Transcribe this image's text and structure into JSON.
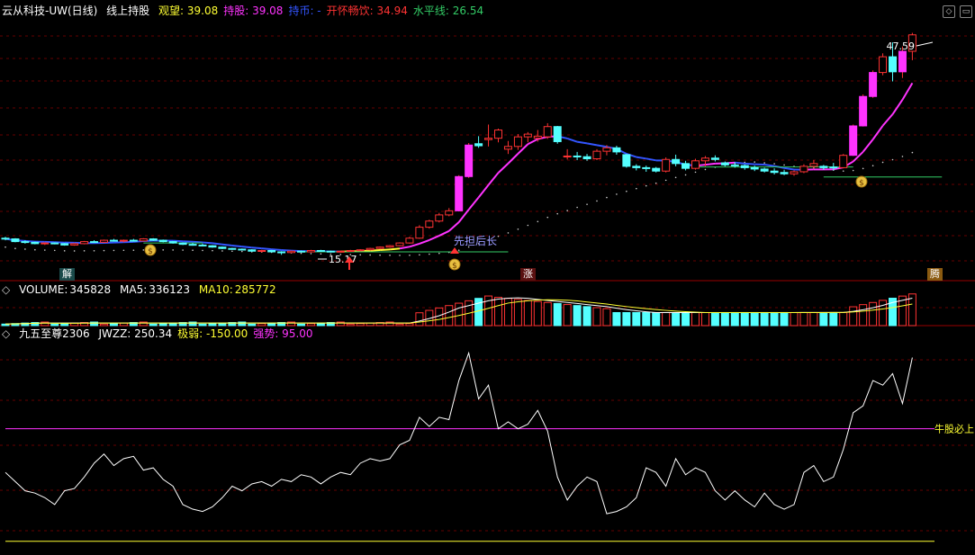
{
  "main_header": {
    "title": "云从科技-UW(日线)",
    "indicator": "线上持股",
    "items": [
      {
        "label": "观望:",
        "value": "39.08",
        "color": "#ffff33"
      },
      {
        "label": "持股:",
        "value": "39.08",
        "color": "#ff33ff"
      },
      {
        "label": "持币:",
        "value": "-",
        "color": "#3355ff"
      },
      {
        "label": "开怀畅饮:",
        "value": "34.94",
        "color": "#ff3333"
      },
      {
        "label": "水平线:",
        "value": "26.54",
        "color": "#33cc66"
      }
    ]
  },
  "volume_header": {
    "label": "VOLUME:",
    "value": "345828",
    "ma5_label": "MA5:",
    "ma5": "336123",
    "ma10_label": "MA10:",
    "ma10": "285772"
  },
  "osc_header": {
    "name": "九五至尊2306",
    "items": [
      {
        "label": "JWZZ:",
        "value": "250.34",
        "color": "#ffffff"
      },
      {
        "label": "极弱:",
        "value": "-150.00",
        "color": "#ffff33"
      },
      {
        "label": "强势:",
        "value": "95.00",
        "color": "#ff33ff"
      }
    ]
  },
  "annotations": {
    "high_price": "47.59",
    "low_price": "15.17",
    "text_mark": "先担后长",
    "osc_line_label": "牛股必上"
  },
  "tags": {
    "jie": "解",
    "zhang": "涨",
    "teng": "腾"
  },
  "colors": {
    "up": "#ff3333",
    "down": "#54ffff",
    "magenta": "#ff33ff",
    "blue": "#3355ff",
    "yellow": "#ffff33",
    "green": "#33cc66",
    "grid": "#660000"
  },
  "chart_data": {
    "type": "candlestick",
    "price_range": [
      13.5,
      49.5
    ],
    "candles": [
      [
        17.6,
        17.8,
        17.3,
        17.5
      ],
      [
        17.5,
        17.6,
        17.0,
        17.1
      ],
      [
        17.1,
        17.3,
        16.8,
        17.0
      ],
      [
        17.0,
        17.1,
        16.7,
        16.8
      ],
      [
        16.8,
        17.0,
        16.6,
        16.9
      ],
      [
        16.9,
        17.0,
        16.7,
        16.8
      ],
      [
        16.8,
        16.9,
        16.5,
        16.6
      ],
      [
        16.6,
        16.9,
        16.5,
        16.8
      ],
      [
        16.8,
        17.2,
        16.7,
        17.1
      ],
      [
        17.1,
        17.3,
        16.9,
        17.0
      ],
      [
        17.0,
        17.4,
        16.9,
        17.3
      ],
      [
        17.3,
        17.5,
        17.1,
        17.2
      ],
      [
        17.2,
        17.4,
        17.0,
        17.3
      ],
      [
        17.3,
        17.5,
        17.1,
        17.2
      ],
      [
        17.2,
        17.6,
        17.1,
        17.5
      ],
      [
        17.5,
        17.6,
        17.2,
        17.3
      ],
      [
        17.3,
        17.4,
        17.0,
        17.1
      ],
      [
        17.1,
        17.2,
        16.8,
        16.9
      ],
      [
        16.9,
        17.0,
        16.6,
        16.7
      ],
      [
        16.7,
        16.9,
        16.5,
        16.6
      ],
      [
        16.6,
        16.8,
        16.4,
        16.5
      ],
      [
        16.5,
        16.6,
        16.2,
        16.3
      ],
      [
        16.3,
        16.4,
        16.0,
        16.1
      ],
      [
        16.1,
        16.2,
        15.9,
        16.0
      ],
      [
        16.0,
        16.1,
        15.8,
        15.9
      ],
      [
        15.9,
        16.0,
        15.6,
        15.7
      ],
      [
        15.7,
        15.9,
        15.5,
        15.8
      ],
      [
        15.8,
        15.9,
        15.5,
        15.6
      ],
      [
        15.6,
        15.7,
        15.17,
        15.5
      ],
      [
        15.5,
        15.8,
        15.4,
        15.7
      ],
      [
        15.7,
        15.8,
        15.5,
        15.6
      ],
      [
        15.6,
        15.9,
        15.5,
        15.8
      ],
      [
        15.8,
        15.9,
        15.6,
        15.7
      ],
      [
        15.7,
        15.8,
        15.5,
        15.6
      ],
      [
        15.6,
        15.8,
        15.5,
        15.7
      ],
      [
        15.7,
        15.9,
        15.6,
        15.8
      ],
      [
        15.8,
        16.0,
        15.7,
        15.9
      ],
      [
        15.9,
        16.2,
        15.8,
        16.1
      ],
      [
        16.1,
        16.4,
        16.0,
        16.3
      ],
      [
        16.3,
        16.6,
        16.2,
        16.5
      ],
      [
        16.5,
        17.0,
        16.4,
        16.9
      ],
      [
        16.9,
        17.8,
        16.8,
        17.6
      ],
      [
        17.6,
        19.5,
        17.5,
        19.2
      ],
      [
        19.2,
        20.3,
        19.0,
        20.1
      ],
      [
        20.1,
        21.3,
        19.9,
        21.0
      ],
      [
        21.0,
        22.0,
        20.8,
        21.6
      ],
      [
        21.6,
        26.8,
        21.5,
        26.6
      ],
      [
        26.6,
        31.5,
        26.4,
        31.2
      ],
      [
        31.4,
        32.5,
        30.8,
        31.1
      ],
      [
        32.0,
        34.2,
        31.0,
        32.2
      ],
      [
        32.2,
        33.6,
        31.6,
        33.4
      ],
      [
        30.6,
        31.8,
        29.9,
        31.0
      ],
      [
        31.0,
        32.8,
        30.5,
        32.4
      ],
      [
        32.4,
        33.1,
        31.6,
        32.8
      ],
      [
        32.2,
        33.4,
        31.7,
        32.5
      ],
      [
        32.4,
        34.4,
        32.1,
        33.9
      ],
      [
        33.9,
        34.0,
        31.4,
        31.7
      ],
      [
        29.6,
        30.6,
        29.1,
        29.6
      ],
      [
        29.6,
        30.2,
        29.0,
        29.5
      ],
      [
        29.5,
        29.9,
        28.9,
        29.2
      ],
      [
        29.2,
        30.6,
        29.0,
        30.3
      ],
      [
        30.3,
        31.2,
        29.7,
        30.8
      ],
      [
        30.8,
        31.1,
        29.8,
        30.2
      ],
      [
        29.8,
        29.9,
        27.9,
        28.1
      ],
      [
        28.1,
        28.4,
        27.5,
        27.9
      ],
      [
        27.9,
        28.2,
        27.3,
        27.8
      ],
      [
        27.8,
        28.0,
        27.2,
        27.4
      ],
      [
        27.4,
        29.4,
        27.2,
        29.1
      ],
      [
        29.1,
        29.8,
        28.1,
        28.5
      ],
      [
        28.5,
        28.9,
        27.5,
        27.8
      ],
      [
        27.8,
        29.2,
        27.6,
        28.9
      ],
      [
        28.9,
        29.6,
        28.1,
        29.3
      ],
      [
        29.3,
        29.7,
        28.8,
        29.1
      ],
      [
        28.6,
        28.8,
        28.1,
        28.3
      ],
      [
        28.3,
        28.7,
        27.9,
        28.2
      ],
      [
        28.2,
        28.4,
        27.6,
        27.9
      ],
      [
        27.9,
        28.2,
        27.4,
        27.7
      ],
      [
        27.7,
        27.9,
        27.2,
        27.4
      ],
      [
        27.4,
        27.8,
        26.9,
        27.2
      ],
      [
        27.2,
        27.6,
        26.8,
        27.0
      ],
      [
        27.0,
        27.5,
        26.7,
        27.3
      ],
      [
        27.3,
        28.4,
        27.1,
        28.1
      ],
      [
        28.1,
        29.0,
        27.8,
        28.5
      ],
      [
        28.1,
        28.3,
        27.6,
        27.9
      ],
      [
        28.0,
        28.6,
        27.5,
        27.9
      ],
      [
        27.9,
        29.9,
        27.8,
        29.7
      ],
      [
        29.7,
        34.2,
        29.6,
        34.0
      ],
      [
        34.0,
        38.6,
        33.9,
        38.3
      ],
      [
        38.3,
        42.1,
        38.1,
        41.8
      ],
      [
        41.8,
        44.6,
        41.4,
        44.1
      ],
      [
        44.1,
        46.2,
        40.5,
        41.9
      ],
      [
        41.9,
        45.6,
        41.0,
        44.9
      ],
      [
        44.9,
        47.59,
        43.6,
        47.3
      ]
    ],
    "volume_range": [
      0,
      420000
    ]
  }
}
